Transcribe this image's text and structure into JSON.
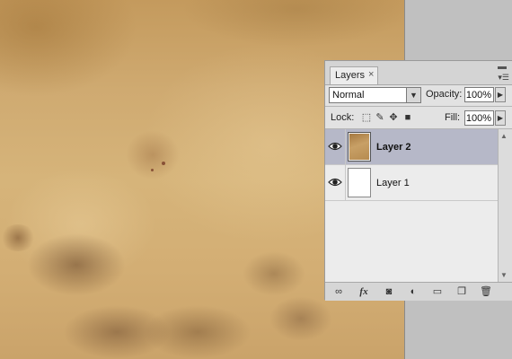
{
  "canvas": {
    "description_color": "#d2ae74"
  },
  "panel": {
    "tab_label": "Layers",
    "tab_close": "×",
    "blend_mode": "Normal",
    "opacity_label": "Opacity:",
    "opacity_value": "100%",
    "lock_label": "Lock:",
    "fill_label": "Fill:",
    "fill_value": "100%",
    "stepper_glyph": "▶",
    "layers": [
      {
        "name": "Layer 2",
        "selected": true,
        "visible": true,
        "thumbnail": "paper"
      },
      {
        "name": "Layer 1",
        "selected": false,
        "visible": true,
        "thumbnail": "white"
      }
    ],
    "lock_icons": [
      "lock-transparent-icon",
      "lock-paint-icon",
      "lock-move-icon",
      "lock-all-icon"
    ],
    "bottom_icons": [
      "link-icon",
      "fx-icon",
      "add-mask-icon",
      "adjustment-layer-icon",
      "new-group-icon",
      "new-layer-icon",
      "trash-icon"
    ],
    "fx_label": "fx"
  },
  "colors": {
    "selection": "#b6b8c8",
    "panel_bg": "#e2e2e2",
    "workspace": "#c0c0c0"
  }
}
